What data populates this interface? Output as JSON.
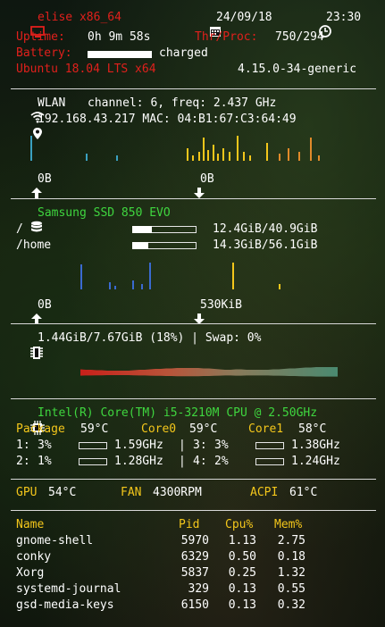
{
  "header": {
    "hostname": "elise x86_64",
    "date": "24/09/18",
    "time": "23:30",
    "uptime_label": "Uptime:",
    "uptime_value": "0h 9m 58s",
    "thr_label": "Thr/Proc:",
    "thr_value": "750/294",
    "battery_label": "Battery:",
    "battery_status": "charged",
    "battery_level": 1.0,
    "os": "Ubuntu 18.04 LTS x64",
    "kernel": "4.15.0-34-generic"
  },
  "network": {
    "iface": "WLAN",
    "channel_info": "channel: 6, freq: 2.437 GHz",
    "ip_line": "192.168.43.217 MAC: 04:B1:67:C3:64:49",
    "up": "0B",
    "down": "0B"
  },
  "disk": {
    "model": "Samsung SSD 850 EVO",
    "mounts": [
      {
        "path": "/",
        "usage": "12.4GiB/40.9GiB",
        "fraction": 0.3
      },
      {
        "path": "/home",
        "usage": "14.3GiB/56.1GiB",
        "fraction": 0.25
      }
    ],
    "read": "0B",
    "write": "530KiB"
  },
  "memory": {
    "line": "1.44GiB/7.67GiB (18%) | Swap: 0%"
  },
  "cpu": {
    "name": "Intel(R) Core(TM) i5-3210M CPU @ 2.50GHz",
    "package_label": "Package",
    "package_temp": "59°C",
    "core0_label": "Core0",
    "core0_temp": "59°C",
    "core1_label": "Core1",
    "core1_temp": "58°C",
    "cores": [
      {
        "id": "1:",
        "pct": "3%",
        "freq": "1.59GHz",
        "level": 0.03
      },
      {
        "id": "3:",
        "pct": "3%",
        "freq": "1.38GHz",
        "level": 0.03
      },
      {
        "id": "2:",
        "pct": "1%",
        "freq": "1.28GHz",
        "level": 0.01
      },
      {
        "id": "4:",
        "pct": "2%",
        "freq": "1.24GHz",
        "level": 0.02
      }
    ],
    "sep": "|"
  },
  "sensors": {
    "gpu_label": "GPU",
    "gpu_temp": "54°C",
    "fan_label": "FAN",
    "fan_value": "4300RPM",
    "acpi_label": "ACPI",
    "acpi_temp": "61°C"
  },
  "processes": {
    "headers": [
      "Name",
      "Pid",
      "Cpu%",
      "Mem%"
    ],
    "rows": [
      [
        "gnome-shell",
        "5970",
        "1.13",
        "2.75"
      ],
      [
        "conky",
        "6329",
        "0.50",
        "0.18"
      ],
      [
        "Xorg",
        "5837",
        "0.25",
        "1.32"
      ],
      [
        "systemd-journal",
        "329",
        "0.13",
        "0.55"
      ],
      [
        "gsd-media-keys",
        "6150",
        "0.13",
        "0.32"
      ]
    ]
  },
  "colors": {
    "red": "#e0201c",
    "green": "#3fd63f",
    "yellow": "#f3c61b"
  }
}
